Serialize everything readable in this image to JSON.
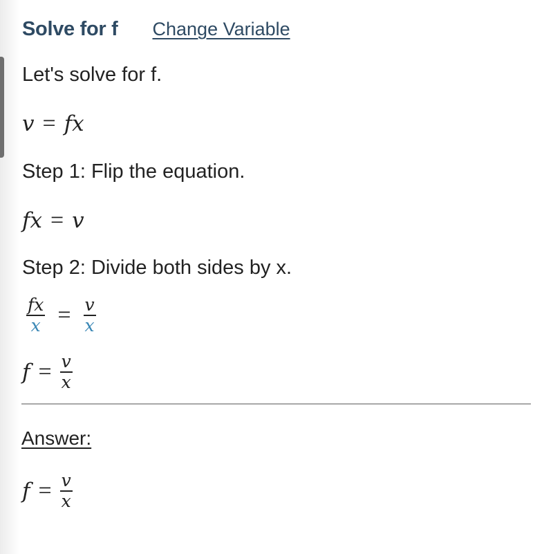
{
  "header": {
    "title": "Solve for f",
    "change_variable_link": "Change Variable"
  },
  "intro": "Let's solve for f.",
  "equation_initial": {
    "lhs": "v",
    "op": "=",
    "rhs": "fx"
  },
  "steps": [
    {
      "label": "Step 1: Flip the equation.",
      "result": {
        "lhs": "fx",
        "op": "=",
        "rhs": "v"
      }
    },
    {
      "label": "Step 2: Divide both sides by x.",
      "work": {
        "lhs_num": "fx",
        "lhs_den": "x",
        "op": "=",
        "rhs_num": "v",
        "rhs_den": "x"
      },
      "result": {
        "lhs": "f",
        "op": "=",
        "rhs_num": "v",
        "rhs_den": "x"
      }
    }
  ],
  "answer": {
    "label": "Answer:",
    "lhs": "f",
    "op": "=",
    "rhs_num": "v",
    "rhs_den": "x"
  },
  "colors": {
    "title": "#2e4a63",
    "highlight_divisor": "#3a87b5",
    "divider": "#a8a8a8"
  }
}
